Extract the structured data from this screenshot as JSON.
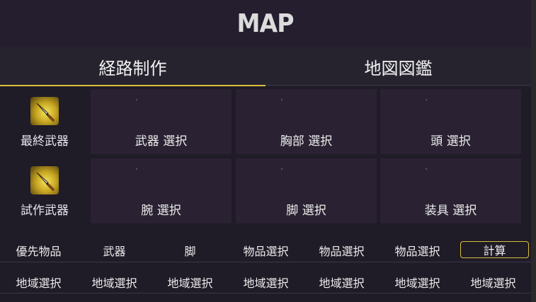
{
  "header": {
    "title": "MAP"
  },
  "tabs": [
    {
      "label": "経路制作",
      "active": true
    },
    {
      "label": "地図図鑑",
      "active": false
    }
  ],
  "accent_color": "#d9bf3d",
  "rows": [
    {
      "weapon_label": "最終武器",
      "weapon_icon": "golden-knife-icon",
      "slots": [
        "武器 選択",
        "胸部 選択",
        "頭 選択"
      ]
    },
    {
      "weapon_label": "試作武器",
      "weapon_icon": "golden-knife-icon",
      "slots": [
        "腕 選択",
        "脚 選択",
        "装具 選択"
      ]
    }
  ],
  "filters": [
    "優先物品",
    "武器",
    "脚",
    "物品選択",
    "物品選択",
    "物品選択"
  ],
  "calculate_label": "計算",
  "regions": [
    "地域選択",
    "地域選択",
    "地域選択",
    "地域選択",
    "地域選択",
    "地域選択",
    "地域選択"
  ]
}
